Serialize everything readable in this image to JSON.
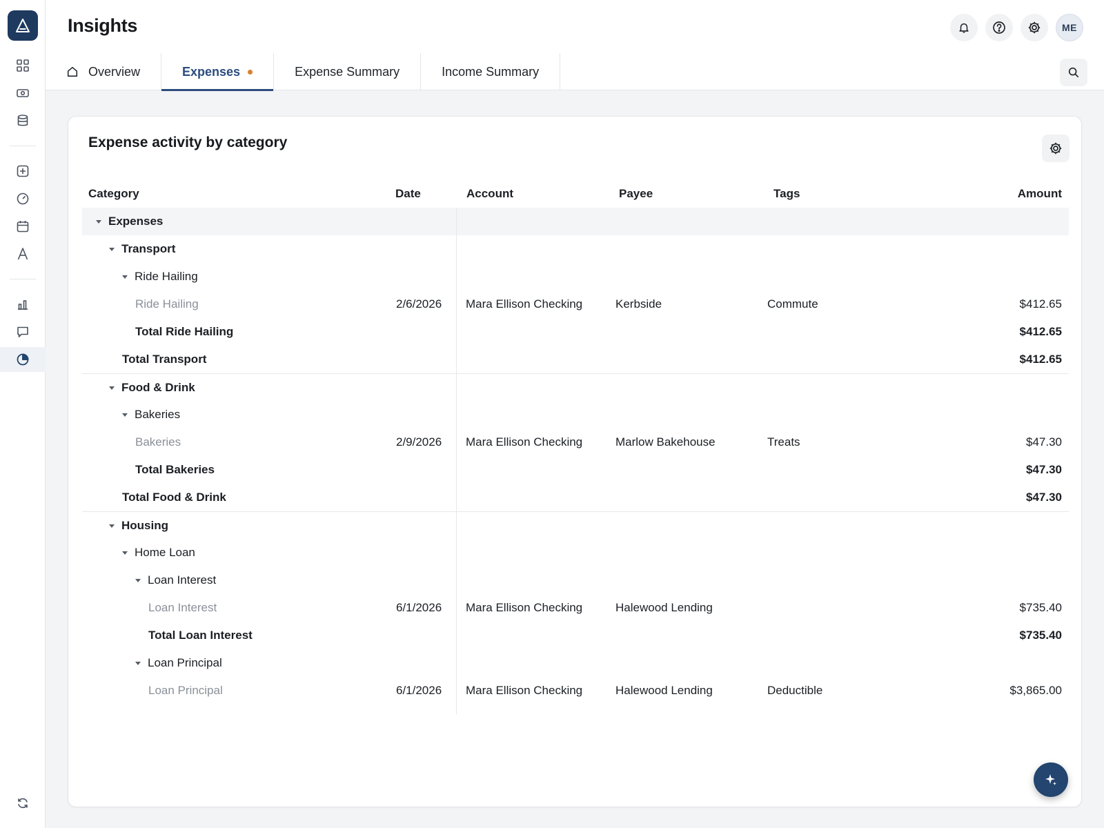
{
  "app": {
    "logo_icon": "logo-a-icon",
    "page_title": "Insights"
  },
  "sidebar": {
    "items": [
      {
        "icon": "grid-icon"
      },
      {
        "icon": "cash-icon"
      },
      {
        "icon": "database-icon"
      },
      {
        "icon": "plus-square-icon"
      },
      {
        "icon": "gauge-icon"
      },
      {
        "icon": "calendar-icon"
      },
      {
        "icon": "letter-a-icon"
      },
      {
        "icon": "bar-chart-icon"
      },
      {
        "icon": "chat-icon"
      },
      {
        "icon": "pie-chart-icon",
        "active": true
      }
    ],
    "bottom_icon": "sync-icon"
  },
  "header": {
    "avatar_initials": "ME",
    "tabs": [
      {
        "label": "Overview",
        "icon": "home-icon"
      },
      {
        "label": "Expenses",
        "active": true,
        "unsaved_dot_color": "#d9822b"
      },
      {
        "label": "Expense Summary"
      },
      {
        "label": "Income Summary"
      }
    ]
  },
  "report": {
    "title": "Expense activity by category",
    "columns": {
      "category": "Category",
      "date": "Date",
      "account": "Account",
      "payee": "Payee",
      "tags": "Tags",
      "amount": "Amount"
    },
    "rows": [
      {
        "category": "Expenses",
        "level": 0,
        "caret": true,
        "bold": true,
        "shade": true
      },
      {
        "category": "Transport",
        "level": 1,
        "caret": true,
        "bold": true
      },
      {
        "category": "Ride Hailing",
        "level": 2,
        "caret": true
      },
      {
        "category": "Ride Hailing",
        "level": 3,
        "muted": true,
        "date": "2/6/2026",
        "account": "Mara Ellison Checking",
        "payee": "Kerbside",
        "tags": "Commute",
        "amount": "$412.65"
      },
      {
        "category": "Total Ride Hailing",
        "level": 3,
        "bold": true,
        "amount": "$412.65"
      },
      {
        "category": "Total Transport",
        "level": 2,
        "bold": true,
        "amount": "$412.65"
      },
      {
        "category": "Food & Drink",
        "level": 1,
        "caret": true,
        "bold": true,
        "sep": true
      },
      {
        "category": "Bakeries",
        "level": 2,
        "caret": true
      },
      {
        "category": "Bakeries",
        "level": 3,
        "muted": true,
        "date": "2/9/2026",
        "account": "Mara Ellison Checking",
        "payee": "Marlow Bakehouse",
        "tags": "Treats",
        "amount": "$47.30"
      },
      {
        "category": "Total Bakeries",
        "level": 3,
        "bold": true,
        "amount": "$47.30"
      },
      {
        "category": "Total Food & Drink",
        "level": 2,
        "bold": true,
        "amount": "$47.30"
      },
      {
        "category": "Housing",
        "level": 1,
        "caret": true,
        "bold": true,
        "sep": true
      },
      {
        "category": "Home Loan",
        "level": 2,
        "caret": true
      },
      {
        "category": "Loan Interest",
        "level": 3,
        "caret": true
      },
      {
        "category": "Loan Interest",
        "level": 4,
        "muted": true,
        "date": "6/1/2026",
        "account": "Mara Ellison Checking",
        "payee": "Halewood Lending",
        "tags": "",
        "amount": "$735.40"
      },
      {
        "category": "Total Loan Interest",
        "level": 4,
        "bold": true,
        "amount": "$735.40"
      },
      {
        "category": "Loan Principal",
        "level": 3,
        "caret": true
      },
      {
        "category": "Loan Principal",
        "level": 4,
        "muted": true,
        "date": "6/1/2026",
        "account": "Mara Ellison Checking",
        "payee": "Halewood Lending",
        "tags": "Deductible",
        "amount": "$3,865.00"
      }
    ]
  },
  "fab_icon": "sparkle-icon"
}
